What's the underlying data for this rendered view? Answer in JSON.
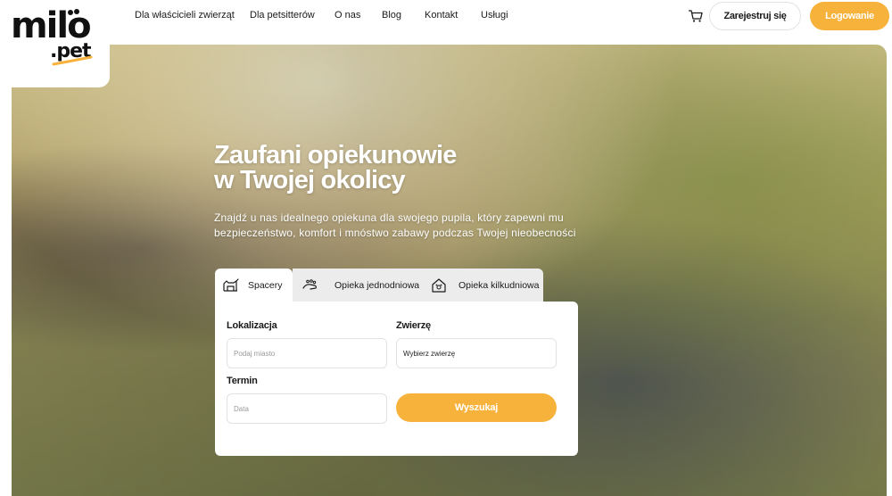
{
  "brand": {
    "logo_text_top": "milo",
    "logo_text_bottom": ".pet",
    "accent_color": "#f7b23b"
  },
  "nav": {
    "links": [
      "Dla właścicieli zwierząt",
      "Dla petsitterów",
      "O nas",
      "Blog",
      "Kontakt",
      "Usługi"
    ],
    "cart_icon": "cart-icon",
    "register_label": "Zarejestruj się",
    "login_label": "Logowanie"
  },
  "hero": {
    "title_line1": "Zaufani opiekunowie",
    "title_line2": "w Twojej okolicy",
    "desc_line1": "Znajdź u nas idealnego opiekuna dla swojego pupila, który zapewni mu",
    "desc_line2": "bezpieczeństwo, komfort i mnóstwo zabawy podczas Twojej nieobecności"
  },
  "tabs": [
    {
      "label": "Spacery",
      "icon": "dog-walk-icon",
      "active": true
    },
    {
      "label": "Opieka jednodniowa",
      "icon": "paw-hand-icon",
      "active": false
    },
    {
      "label": "Opieka kilkudniowa",
      "icon": "pet-house-icon",
      "active": false
    }
  ],
  "search": {
    "location_label": "Lokalizacja",
    "location_placeholder": "Podaj miasto",
    "animal_label": "Zwierzę",
    "animal_value": "Wybierz zwierzę",
    "date_label": "Termin",
    "date_placeholder": "Data",
    "submit_label": "Wyszukaj"
  }
}
